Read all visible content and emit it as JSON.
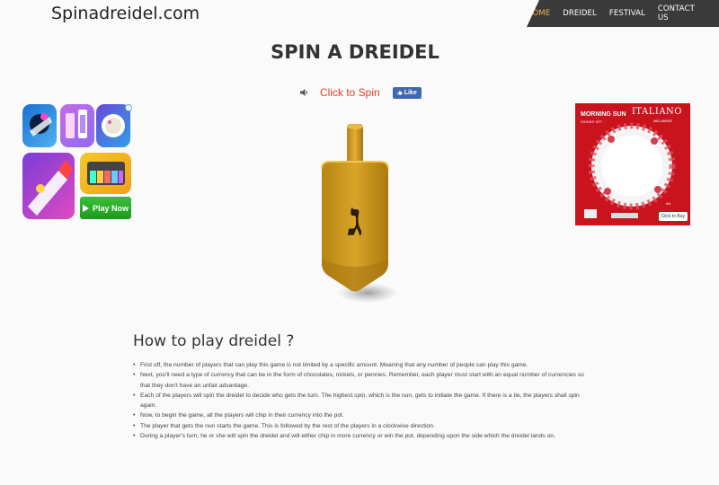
{
  "header": {
    "logo": "Spinadreidel.com",
    "nav": [
      "HOME",
      "DREIDEL",
      "FESTIVAL",
      "CONTACT US"
    ],
    "active_nav": "HOME"
  },
  "page_title": "SPIN A DREIDEL",
  "spin": {
    "button_label": "Click to Spin",
    "like_label": "Like",
    "speaker_icon": "speaker-icon"
  },
  "left_ad": {
    "play_label": "Play Now",
    "badge": "i"
  },
  "right_ad": {
    "brand": "ITALIANO",
    "brand_sub": "MELAMINE",
    "product": "MORNING SUN",
    "collection": "DINNER SET",
    "cta": "Click to Buy",
    "tag": "Art"
  },
  "dreidel": {
    "letter": "ג",
    "colors": {
      "body": "#c8951e",
      "shade": "#a97a10",
      "highlight": "#e8b93a"
    }
  },
  "howto": {
    "heading": "How to play dreidel ?",
    "items": [
      "First off, the number of players that can play this game is not limited by a specific amount. Meaning that any number of people can play this game.",
      "Next, you'll need a type of currency that can be in the form of chocolates, nickels, or pennies. Remember, each player must start with an equal number of currencies so that they don't have an unfair advantage.",
      "Each of the players will spin the dreidel to decide who gets the turn. The highest spin, which is the nun, gets to initiate the game. If there is a tie, the players shall spin again.",
      "Now, to begin the game, all the players will chip in their currency into the pot.",
      "The player that gets the nun starts the game. This is followed by the rest of the players in a clockwise direction.",
      "During a player's turn, he or she will spin the dreidel and will either chip in more currency or win the pot, depending upon the side which the dreidel lands on."
    ]
  }
}
